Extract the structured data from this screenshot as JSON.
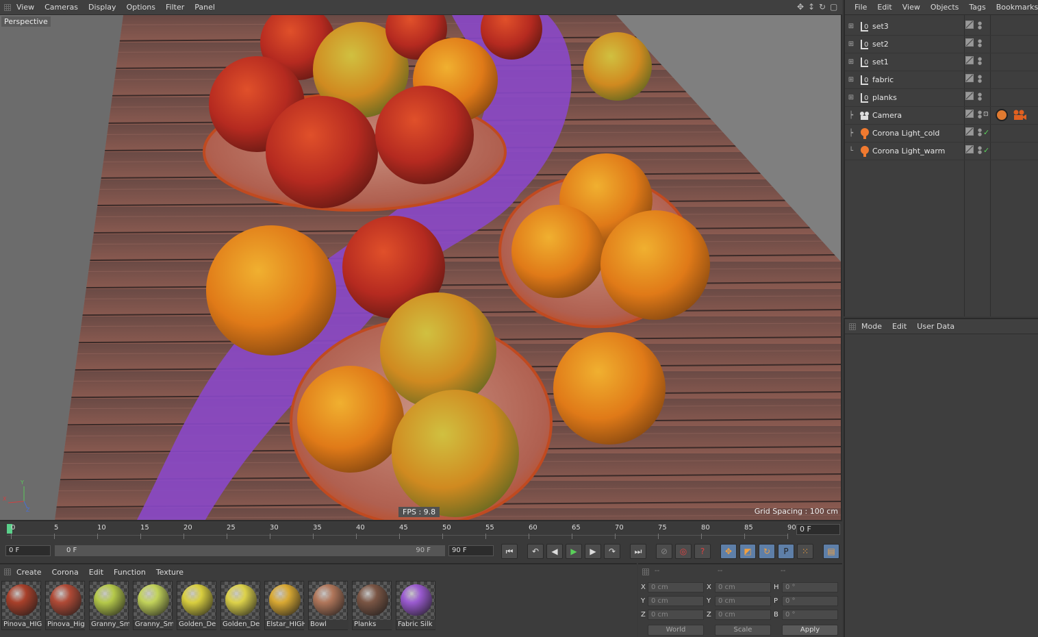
{
  "viewport": {
    "menu": [
      "View",
      "Cameras",
      "Display",
      "Options",
      "Filter",
      "Panel"
    ],
    "label": "Perspective",
    "fps": "FPS : 9.8",
    "grid_spacing": "Grid Spacing : 100 cm",
    "axis": {
      "x": "X",
      "y": "Y",
      "z": "Z"
    }
  },
  "object_manager": {
    "menu": [
      "File",
      "Edit",
      "View",
      "Objects",
      "Tags",
      "Bookmarks"
    ],
    "objects": [
      {
        "name": "set3",
        "icon": "null-object-icon"
      },
      {
        "name": "set2",
        "icon": "null-object-icon"
      },
      {
        "name": "set1",
        "icon": "null-object-icon"
      },
      {
        "name": "fabric",
        "icon": "null-object-icon"
      },
      {
        "name": "planks",
        "icon": "null-object-icon"
      },
      {
        "name": "Camera",
        "icon": "camera-icon"
      },
      {
        "name": "Corona Light_cold",
        "icon": "light-icon"
      },
      {
        "name": "Corona Light_warm",
        "icon": "light-icon"
      }
    ]
  },
  "attributes": {
    "menu": [
      "Mode",
      "Edit",
      "User Data"
    ]
  },
  "timeline": {
    "ticks": [
      "0",
      "5",
      "10",
      "15",
      "20",
      "25",
      "30",
      "35",
      "40",
      "45",
      "50",
      "55",
      "60",
      "65",
      "70",
      "75",
      "80",
      "85",
      "90"
    ],
    "current_frame": "0 F"
  },
  "transport": {
    "start_field": "0 F",
    "range_start": "0 F",
    "range_end": "90 F",
    "end_field": "90 F"
  },
  "materials": {
    "menu": [
      "Create",
      "Corona",
      "Edit",
      "Function",
      "Texture"
    ],
    "items": [
      {
        "name": "Pinova_HIG",
        "color": "#a8402a"
      },
      {
        "name": "Pinova_Hig",
        "color": "#b04a36"
      },
      {
        "name": "Granny_Sm",
        "color": "#b5c94a"
      },
      {
        "name": "Granny_Sm",
        "color": "#c2d35a"
      },
      {
        "name": "Golden_De",
        "color": "#d9cf3f"
      },
      {
        "name": "Golden_De",
        "color": "#ddd24a"
      },
      {
        "name": "Elstar_HIGH",
        "color": "#d9a933"
      },
      {
        "name": "Bowl",
        "color": "#b0765a"
      },
      {
        "name": "Planks",
        "color": "#7a5544"
      },
      {
        "name": "Fabric Silk",
        "color": "#9a5ad0"
      }
    ]
  },
  "coordinates": {
    "headers": [
      "--",
      "--",
      "--"
    ],
    "rows": [
      {
        "l1": "X",
        "v1": "0 cm",
        "l2": "X",
        "v2": "0 cm",
        "l3": "H",
        "v3": "0 °"
      },
      {
        "l1": "Y",
        "v1": "0 cm",
        "l2": "Y",
        "v2": "0 cm",
        "l3": "P",
        "v3": "0 °"
      },
      {
        "l1": "Z",
        "v1": "0 cm",
        "l2": "Z",
        "v2": "0 cm",
        "l3": "B",
        "v3": "0 °"
      }
    ],
    "mode": "World",
    "size_mode": "Scale",
    "apply": "Apply"
  }
}
